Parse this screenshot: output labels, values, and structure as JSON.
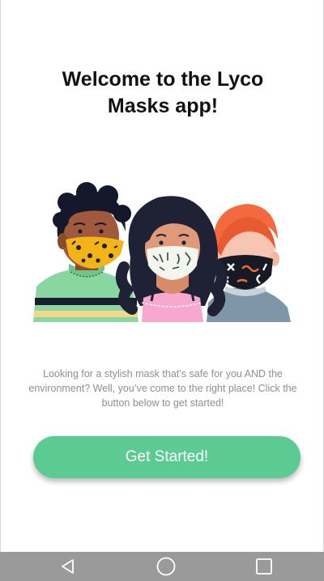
{
  "welcome": {
    "title": "Welcome to the Lyco Masks app!",
    "description": "Looking for a stylish mask that’s safe for you AND the environment? Well, you’ve come to the right place! Click the button below to get started!",
    "cta_label": "Get Started!"
  },
  "illustration": {
    "icon": "three-people-wearing-masks-illustration"
  },
  "navbar": {
    "back_icon": "back-triangle-icon",
    "home_icon": "home-circle-icon",
    "recent_icon": "recent-apps-square-icon"
  },
  "colors": {
    "accent": "#5ccb93",
    "title": "#111111",
    "body_text": "#8f8f8f",
    "navbar": "#9a9a9a"
  }
}
